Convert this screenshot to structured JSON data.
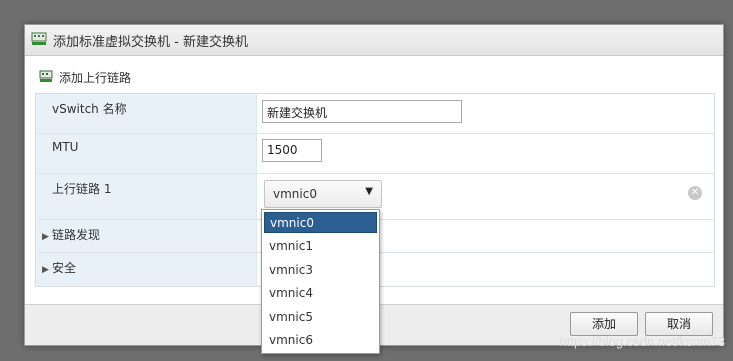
{
  "dialog": {
    "title": "添加标准虚拟交换机 - 新建交换机",
    "subheader": "添加上行链路"
  },
  "form": {
    "vswitch_name_label": "vSwitch 名称",
    "vswitch_name_value": "新建交换机",
    "mtu_label": "MTU",
    "mtu_value": "1500",
    "uplink_label": "上行链路 1",
    "uplink_value": "vmnic0",
    "link_discovery_label": "链路发现",
    "security_label": "安全"
  },
  "dropdown": {
    "options": [
      "vmnic0",
      "vmnic1",
      "vmnic3",
      "vmnic4",
      "vmnic5",
      "vmnic6"
    ],
    "selected": "vmnic0"
  },
  "footer": {
    "add_label": "添加",
    "cancel_label": "取消"
  },
  "watermark": "https://blog.csdn.net/ksnm73",
  "colors": {
    "label_bg": "#e8f1f8",
    "selected_option": "#2b5f91"
  }
}
